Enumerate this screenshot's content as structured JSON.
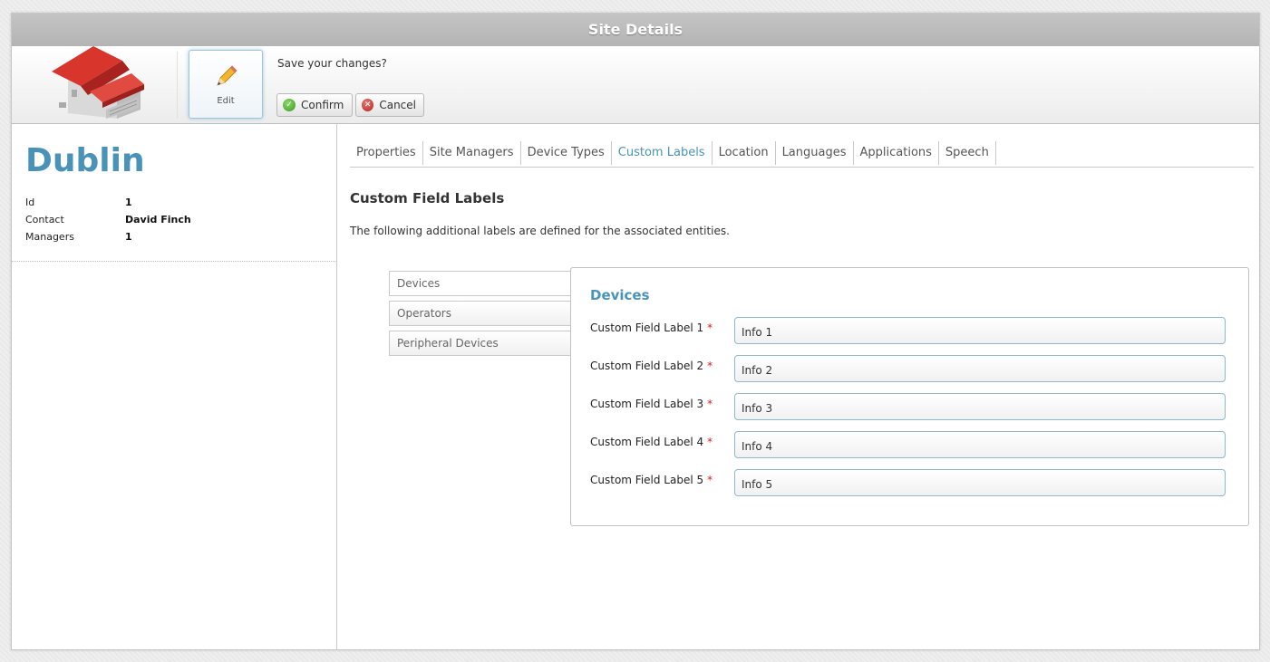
{
  "window": {
    "title": "Site Details"
  },
  "toolbar": {
    "edit_label": "Edit",
    "save_prompt": "Save your changes?",
    "confirm_label": "Confirm",
    "cancel_label": "Cancel"
  },
  "site": {
    "name": "Dublin",
    "info": [
      {
        "label": "Id",
        "value": "1"
      },
      {
        "label": "Contact",
        "value": "David Finch"
      },
      {
        "label": "Managers",
        "value": "1"
      }
    ]
  },
  "tabs": [
    "Properties",
    "Site Managers",
    "Device Types",
    "Custom Labels",
    "Location",
    "Languages",
    "Applications",
    "Speech"
  ],
  "active_tab": "Custom Labels",
  "section": {
    "title": "Custom Field Labels",
    "description": "The following additional labels are defined for the associated entities."
  },
  "entities": [
    "Devices",
    "Operators",
    "Peripheral Devices"
  ],
  "selected_entity": "Devices",
  "detail": {
    "title": "Devices",
    "fields": [
      {
        "label": "Custom Field Label 1",
        "required_mark": "*",
        "value": "Info 1"
      },
      {
        "label": "Custom Field Label 2",
        "required_mark": "*",
        "value": "Info 2"
      },
      {
        "label": "Custom Field Label 3",
        "required_mark": "*",
        "value": "Info 3"
      },
      {
        "label": "Custom Field Label 4",
        "required_mark": "*",
        "value": "Info 4"
      },
      {
        "label": "Custom Field Label 5",
        "required_mark": "*",
        "value": "Info 5"
      }
    ]
  },
  "colors": {
    "accent": "#4a93b8",
    "required": "#d02020",
    "confirm": "#3a9a1f",
    "cancel": "#b0221a"
  },
  "icons": {
    "site": "warehouse-icon",
    "edit": "pencil-icon",
    "confirm": "check-circle-icon",
    "cancel": "x-circle-icon"
  }
}
